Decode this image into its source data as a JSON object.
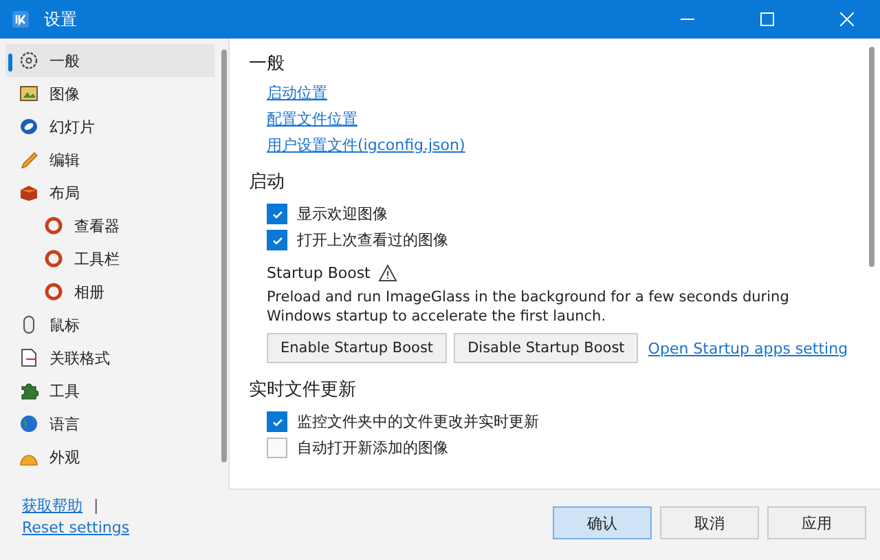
{
  "window": {
    "title": "设置"
  },
  "sidebar": {
    "items": [
      {
        "label": "一般",
        "kind": "gear",
        "selected": true
      },
      {
        "label": "图像",
        "kind": "image",
        "selected": false
      },
      {
        "label": "幻灯片",
        "kind": "lens",
        "selected": false
      },
      {
        "label": "编辑",
        "kind": "pencil",
        "selected": false
      },
      {
        "label": "布局",
        "kind": "box",
        "selected": false,
        "children": [
          {
            "label": "查看器",
            "kind": "ring",
            "selected": false
          },
          {
            "label": "工具栏",
            "kind": "ring",
            "selected": false
          },
          {
            "label": "相册",
            "kind": "ring",
            "selected": false
          }
        ]
      },
      {
        "label": "鼠标",
        "kind": "mouse",
        "selected": false
      },
      {
        "label": "关联格式",
        "kind": "document",
        "selected": false
      },
      {
        "label": "工具",
        "kind": "puzzle",
        "selected": false
      },
      {
        "label": "语言",
        "kind": "globe",
        "selected": false
      },
      {
        "label": "外观",
        "kind": "dome",
        "selected": false
      }
    ],
    "help_link": "获取帮助",
    "separator": "|",
    "reset_link": "Reset settings"
  },
  "sections": [
    {
      "title": "一般",
      "links": [
        "启动位置",
        "配置文件位置",
        "用户设置文件(igconfig.json)"
      ]
    },
    {
      "title": "启动",
      "checkboxes": [
        {
          "label": "显示欢迎图像",
          "checked": true
        },
        {
          "label": "打开上次查看过的图像",
          "checked": true
        }
      ],
      "boost": {
        "title": "Startup Boost",
        "description": "Preload and run ImageGlass in the background for a few seconds during Windows startup to accelerate the first launch.",
        "buttons": [
          "Enable Startup Boost",
          "Disable Startup Boost"
        ],
        "link": "Open Startup apps setting"
      }
    },
    {
      "title": "实时文件更新",
      "checkboxes": [
        {
          "label": "监控文件夹中的文件更改并实时更新",
          "checked": true
        },
        {
          "label": "自动打开新添加的图像",
          "checked": false
        }
      ]
    }
  ],
  "footer_buttons": [
    {
      "label": "确认",
      "primary": true
    },
    {
      "label": "取消",
      "primary": false
    },
    {
      "label": "应用",
      "primary": false
    }
  ]
}
